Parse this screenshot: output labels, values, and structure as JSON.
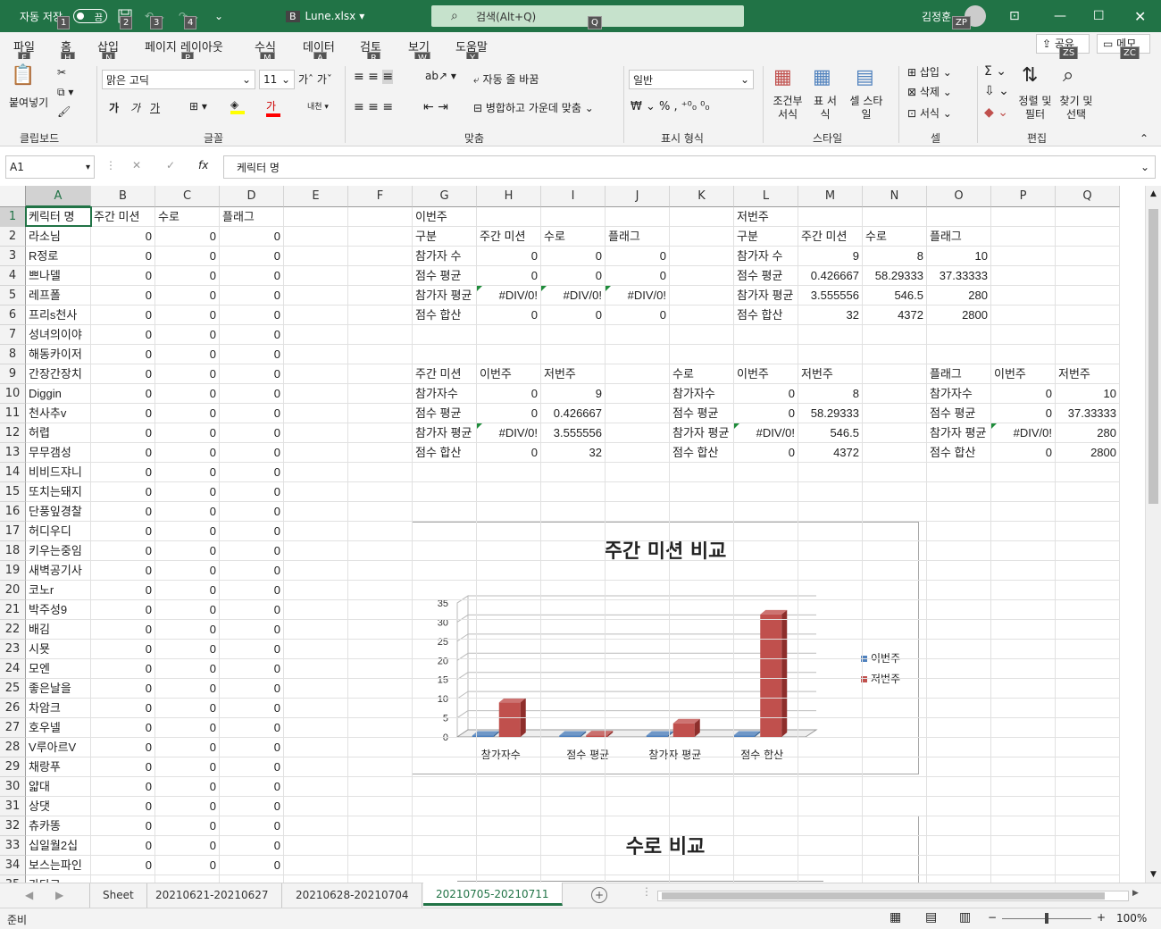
{
  "titlebar": {
    "autosave_label": "자동 저장",
    "autosave_state": "끔",
    "filename": "Lune.xlsx",
    "search_placeholder": "검색(Alt+Q)",
    "user": "김정훈",
    "user_initials": "ZP",
    "keytips": [
      "1",
      "2",
      "3",
      "4",
      "Q"
    ]
  },
  "tabs": [
    {
      "label": "파일",
      "key": "F"
    },
    {
      "label": "홈",
      "key": "H"
    },
    {
      "label": "삽입",
      "key": "N"
    },
    {
      "label": "페이지 레이아웃",
      "key": "P"
    },
    {
      "label": "수식",
      "key": "M"
    },
    {
      "label": "데이터",
      "key": "A"
    },
    {
      "label": "검토",
      "key": "R"
    },
    {
      "label": "보기",
      "key": "W"
    },
    {
      "label": "도움말",
      "key": "Y"
    }
  ],
  "share": {
    "label": "공유",
    "key": "ZS"
  },
  "memo": {
    "label": "메모",
    "key": "ZC"
  },
  "ribbon": {
    "clipboard": {
      "paste": "붙여넣기",
      "label": "클립보드"
    },
    "font": {
      "name": "맑은 고딕",
      "size": "11",
      "label": "글꼴",
      "bold": "가",
      "italic": "가",
      "underline": "가"
    },
    "align": {
      "wrap": "자동 줄 바꿈",
      "merge": "병합하고 가운데 맞춤",
      "label": "맞춤"
    },
    "number": {
      "format": "일반",
      "label": "표시 형식"
    },
    "styles": {
      "cond": "조건부 서식",
      "table": "표 서식",
      "cell": "셀 스타일",
      "label": "스타일"
    },
    "cells": {
      "insert": "삽입",
      "delete": "삭제",
      "format": "서식",
      "label": "셀"
    },
    "edit": {
      "sort": "정렬 및 필터",
      "find": "찾기 및 선택",
      "label": "편집"
    }
  },
  "formula_bar": {
    "name_box": "A1",
    "formula": "케릭터 명"
  },
  "columns": [
    "A",
    "B",
    "C",
    "D",
    "E",
    "F",
    "G",
    "H",
    "I",
    "J",
    "K",
    "L",
    "M",
    "N",
    "O",
    "P",
    "Q"
  ],
  "rows": [
    [
      "케릭터 명",
      "주간 미션",
      "수로",
      "플래그",
      "",
      "",
      "이번주",
      "",
      "",
      "",
      "",
      "저번주",
      "",
      "",
      "",
      "",
      ""
    ],
    [
      "라소님",
      "0",
      "0",
      "0",
      "",
      "",
      "구분",
      "주간 미션",
      "수로",
      "플래그",
      "",
      "구분",
      "주간 미션",
      "수로",
      "플래그",
      "",
      ""
    ],
    [
      "R정로",
      "0",
      "0",
      "0",
      "",
      "",
      "참가자 수",
      "0",
      "0",
      "0",
      "",
      "참가자 수",
      "9",
      "8",
      "10",
      "",
      ""
    ],
    [
      "쁘나델",
      "0",
      "0",
      "0",
      "",
      "",
      "점수 평균",
      "0",
      "0",
      "0",
      "",
      "점수 평균",
      "0.426667",
      "58.29333",
      "37.33333",
      "",
      ""
    ],
    [
      "레프폴",
      "0",
      "0",
      "0",
      "",
      "",
      "참가자 평균",
      "#DIV/0!",
      "#DIV/0!",
      "#DIV/0!",
      "",
      "참가자 평균",
      "3.555556",
      "546.5",
      "280",
      "",
      ""
    ],
    [
      "프리s천사",
      "0",
      "0",
      "0",
      "",
      "",
      "점수 합산",
      "0",
      "0",
      "0",
      "",
      "점수 합산",
      "32",
      "4372",
      "2800",
      "",
      ""
    ],
    [
      "성녀의이야",
      "0",
      "0",
      "0",
      "",
      "",
      "",
      "",
      "",
      "",
      "",
      "",
      "",
      "",
      "",
      "",
      ""
    ],
    [
      "해동카이저",
      "0",
      "0",
      "0",
      "",
      "",
      "",
      "",
      "",
      "",
      "",
      "",
      "",
      "",
      "",
      "",
      ""
    ],
    [
      "간장간장치",
      "0",
      "0",
      "0",
      "",
      "",
      "주간 미션",
      "이번주",
      "저번주",
      "",
      "수로",
      "이번주",
      "저번주",
      "",
      "플래그",
      "이번주",
      "저번주"
    ],
    [
      "Diggin",
      "0",
      "0",
      "0",
      "",
      "",
      "참가자수",
      "0",
      "9",
      "",
      "참가자수",
      "0",
      "8",
      "",
      "참가자수",
      "0",
      "10"
    ],
    [
      "천사추v",
      "0",
      "0",
      "0",
      "",
      "",
      "점수 평균",
      "0",
      "0.426667",
      "",
      "점수 평균",
      "0",
      "58.29333",
      "",
      "점수 평균",
      "0",
      "37.33333"
    ],
    [
      "허렵",
      "0",
      "0",
      "0",
      "",
      "",
      "참가자 평균",
      "#DIV/0!",
      "3.555556",
      "",
      "참가자 평균",
      "#DIV/0!",
      "546.5",
      "",
      "참가자 평균",
      "#DIV/0!",
      "280"
    ],
    [
      "무무갬성",
      "0",
      "0",
      "0",
      "",
      "",
      "점수 합산",
      "0",
      "32",
      "",
      "점수 합산",
      "0",
      "4372",
      "",
      "점수 합산",
      "0",
      "2800"
    ],
    [
      "비비드쟈니",
      "0",
      "0",
      "0",
      "",
      "",
      "",
      "",
      "",
      "",
      "",
      "",
      "",
      "",
      "",
      "",
      ""
    ],
    [
      "또치는돼지",
      "0",
      "0",
      "0",
      "",
      "",
      "",
      "",
      "",
      "",
      "",
      "",
      "",
      "",
      "",
      "",
      ""
    ],
    [
      "단풍잎경찰",
      "0",
      "0",
      "0",
      "",
      "",
      "",
      "",
      "",
      "",
      "",
      "",
      "",
      "",
      "",
      "",
      ""
    ],
    [
      "허디우디",
      "0",
      "0",
      "0",
      "",
      "",
      "",
      "",
      "",
      "",
      "",
      "",
      "",
      "",
      "",
      "",
      ""
    ],
    [
      "키우는중임",
      "0",
      "0",
      "0",
      "",
      "",
      "",
      "",
      "",
      "",
      "",
      "",
      "",
      "",
      "",
      "",
      ""
    ],
    [
      "새벽공기사",
      "0",
      "0",
      "0",
      "",
      "",
      "",
      "",
      "",
      "",
      "",
      "",
      "",
      "",
      "",
      "",
      ""
    ],
    [
      "코노r",
      "0",
      "0",
      "0",
      "",
      "",
      "",
      "",
      "",
      "",
      "",
      "",
      "",
      "",
      "",
      "",
      ""
    ],
    [
      "박주성9",
      "0",
      "0",
      "0",
      "",
      "",
      "",
      "",
      "",
      "",
      "",
      "",
      "",
      "",
      "",
      "",
      ""
    ],
    [
      "배김",
      "0",
      "0",
      "0",
      "",
      "",
      "",
      "",
      "",
      "",
      "",
      "",
      "",
      "",
      "",
      "",
      ""
    ],
    [
      "시묫",
      "0",
      "0",
      "0",
      "",
      "",
      "",
      "",
      "",
      "",
      "",
      "",
      "",
      "",
      "",
      "",
      ""
    ],
    [
      "모엔",
      "0",
      "0",
      "0",
      "",
      "",
      "",
      "",
      "",
      "",
      "",
      "",
      "",
      "",
      "",
      "",
      ""
    ],
    [
      "좋은날을",
      "0",
      "0",
      "0",
      "",
      "",
      "",
      "",
      "",
      "",
      "",
      "",
      "",
      "",
      "",
      "",
      ""
    ],
    [
      "차암크",
      "0",
      "0",
      "0",
      "",
      "",
      "",
      "",
      "",
      "",
      "",
      "",
      "",
      "",
      "",
      "",
      ""
    ],
    [
      "호우넬",
      "0",
      "0",
      "0",
      "",
      "",
      "",
      "",
      "",
      "",
      "",
      "",
      "",
      "",
      "",
      "",
      ""
    ],
    [
      "V루아르V",
      "0",
      "0",
      "0",
      "",
      "",
      "",
      "",
      "",
      "",
      "",
      "",
      "",
      "",
      "",
      "",
      ""
    ],
    [
      "채랑푸",
      "0",
      "0",
      "0",
      "",
      "",
      "",
      "",
      "",
      "",
      "",
      "",
      "",
      "",
      "",
      "",
      ""
    ],
    [
      "얇대",
      "0",
      "0",
      "0",
      "",
      "",
      "",
      "",
      "",
      "",
      "",
      "",
      "",
      "",
      "",
      "",
      ""
    ],
    [
      "상댓",
      "0",
      "0",
      "0",
      "",
      "",
      "",
      "",
      "",
      "",
      "",
      "",
      "",
      "",
      "",
      "",
      ""
    ],
    [
      "츄카똥",
      "0",
      "0",
      "0",
      "",
      "",
      "",
      "",
      "",
      "",
      "",
      "",
      "",
      "",
      "",
      "",
      ""
    ],
    [
      "십일월2십",
      "0",
      "0",
      "0",
      "",
      "",
      "",
      "",
      "",
      "",
      "",
      "",
      "",
      "",
      "",
      "",
      ""
    ],
    [
      "보스는파인",
      "0",
      "0",
      "0",
      "",
      "",
      "",
      "",
      "",
      "",
      "",
      "",
      "",
      "",
      "",
      "",
      ""
    ],
    [
      "가타그",
      "",
      "",
      "",
      "",
      "",
      "",
      "",
      "",
      "",
      "",
      "",
      "",
      "",
      "",
      "",
      ""
    ]
  ],
  "chart_data": [
    {
      "type": "bar",
      "title": "주간 미션 비교",
      "categories": [
        "참가자수",
        "점수 평균",
        "참가자 평균",
        "점수 합산"
      ],
      "series": [
        {
          "name": "이번주",
          "values": [
            0,
            0,
            0,
            0
          ]
        },
        {
          "name": "저번주",
          "values": [
            9,
            0.426667,
            3.555556,
            32
          ]
        }
      ],
      "ylim": [
        0,
        35
      ],
      "yticks": [
        "0",
        "5",
        "10",
        "15",
        "20",
        "25",
        "30",
        "35"
      ],
      "grid": true,
      "legend": "right",
      "colors": [
        "#4f81bd",
        "#c0504d"
      ]
    },
    {
      "type": "bar",
      "title": "수로 비교"
    }
  ],
  "sheets": [
    "Sheet",
    "20210621-20210627",
    "20210628-20210704",
    "20210705-20210711"
  ],
  "active_sheet": 3,
  "status": {
    "ready": "준비",
    "zoom": "100%"
  }
}
